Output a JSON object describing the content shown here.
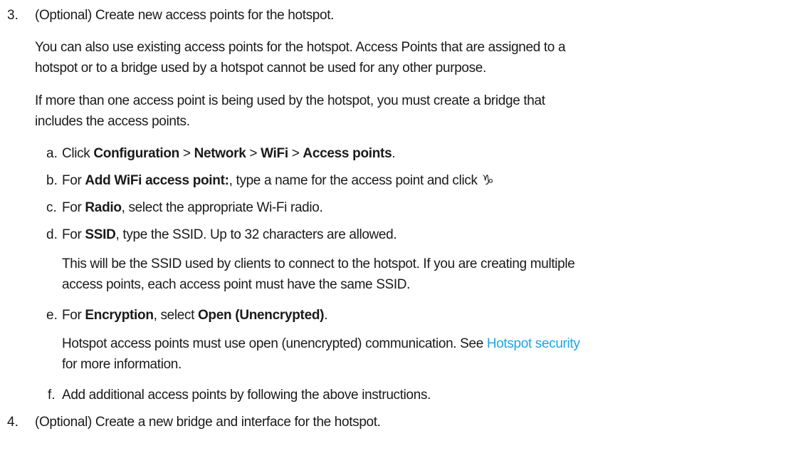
{
  "step3": {
    "number": "3.",
    "text": "(Optional) Create new access points for the hotspot.",
    "para1_line1": "You can also use existing access points for the hotspot. Access Points that are assigned to a",
    "para1_line2": "hotspot or to a bridge used by a hotspot cannot be used for any other purpose.",
    "para2_line1": "If more than one access point is being used by the hotspot, you must create a bridge that",
    "para2_line2": "includes the access points.",
    "substeps": {
      "a": {
        "letter": "a.",
        "prefix": "Click ",
        "b1": "Configuration",
        "sep1": " > ",
        "b2": "Network",
        "sep2": " > ",
        "b3": "WiFi",
        "sep3": " > ",
        "b4": "Access points",
        "suffix": "."
      },
      "b": {
        "letter": "b.",
        "prefix": "For ",
        "bold": "Add WiFi access point:",
        "suffix": ", type a name for the access point and click",
        "icon": "add-icon"
      },
      "c": {
        "letter": "c.",
        "prefix": "For ",
        "bold": "Radio",
        "suffix": ", select the appropriate Wi-Fi radio."
      },
      "d": {
        "letter": "d.",
        "prefix": "For ",
        "bold": "SSID",
        "suffix": ", type the SSID. Up to 32 characters are allowed.",
        "note_line1": "This will be the SSID used by clients to connect to the hotspot. If you are creating multiple",
        "note_line2": "access points, each access point must have the same SSID."
      },
      "e": {
        "letter": "e.",
        "prefix": "For ",
        "bold": "Encryption",
        "mid": ", select ",
        "bold2": "Open (Unencrypted)",
        "suffix": ".",
        "note_line1_pre": "Hotspot access points must use open (unencrypted) communication. See ",
        "note_link": "Hotspot security",
        "note_line2": "for more information."
      },
      "f": {
        "letter": "f.",
        "text": "Add additional access points by following the above instructions."
      }
    }
  },
  "step4": {
    "number": "4.",
    "text": "(Optional) Create a new bridge and interface for the hotspot."
  },
  "colors": {
    "text": "#1a1a1a",
    "link": "#1ea5e6",
    "background": "#ffffff"
  }
}
